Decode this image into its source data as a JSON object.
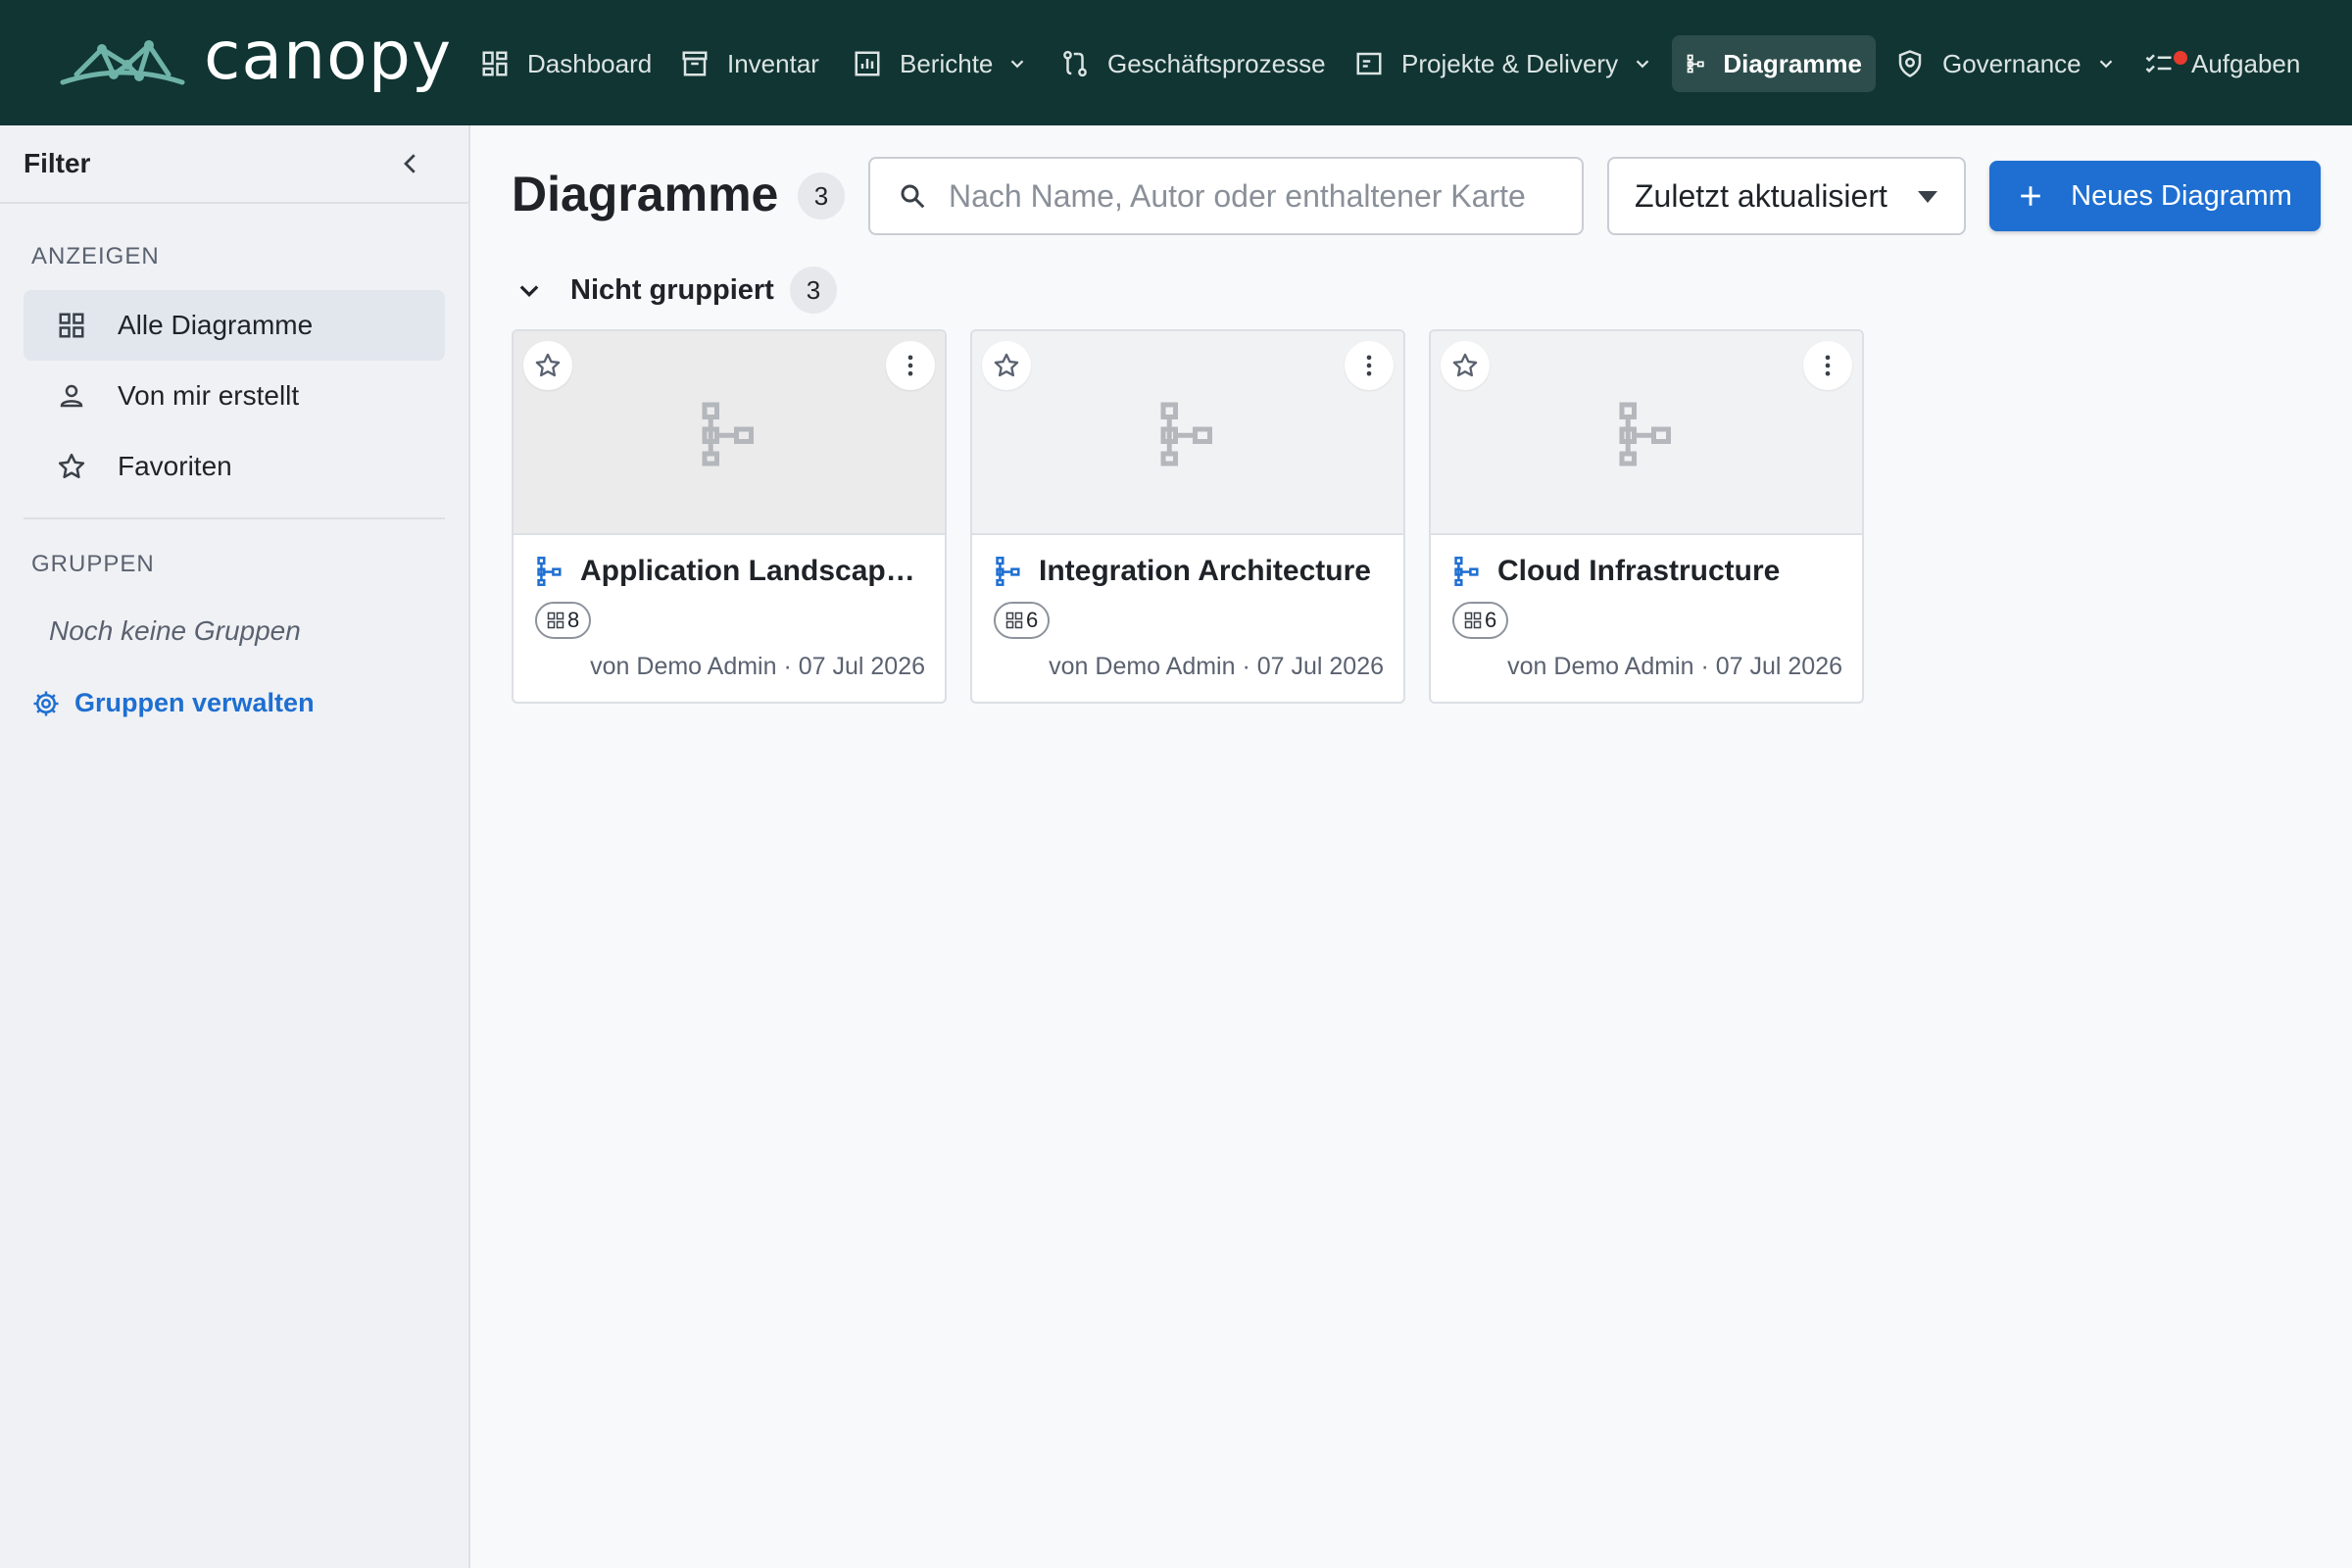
{
  "app": {
    "brand": "canopy",
    "brand_color": "#103533",
    "accent_color": "#1e6fd1"
  },
  "nav": {
    "items": [
      {
        "label": "Dashboard",
        "icon": "dashboard-icon"
      },
      {
        "label": "Inventar",
        "icon": "archive-icon"
      },
      {
        "label": "Berichte",
        "icon": "bar-chart-icon",
        "has_dropdown": true
      },
      {
        "label": "Geschäftsprozesse",
        "icon": "process-icon"
      },
      {
        "label": "Projekte & Delivery",
        "icon": "project-icon",
        "has_dropdown": true
      },
      {
        "label": "Diagramme",
        "icon": "diagram-icon",
        "active": true
      },
      {
        "label": "Governance",
        "icon": "shield-icon",
        "has_dropdown": true
      },
      {
        "label": "Aufgaben",
        "icon": "checklist-icon",
        "has_notification": true
      }
    ]
  },
  "sidebar": {
    "title": "Filter",
    "show_section": "ANZEIGEN",
    "items": [
      {
        "label": "Alle Diagramme",
        "icon": "grid-icon",
        "active": true
      },
      {
        "label": "Von mir erstellt",
        "icon": "user-icon"
      },
      {
        "label": "Favoriten",
        "icon": "star-icon"
      }
    ],
    "groups_section": "GRUPPEN",
    "groups_empty": "Noch keine Gruppen",
    "manage_groups": "Gruppen verwalten"
  },
  "main": {
    "title": "Diagramme",
    "count": "3",
    "search": {
      "placeholder": "Nach Name, Autor oder enthaltener Karte",
      "value": ""
    },
    "sort": {
      "selected": "Zuletzt aktualisiert"
    },
    "new_button": "Neues Diagramm",
    "group": {
      "label": "Nicht gruppiert",
      "count": "3"
    },
    "cards": [
      {
        "title": "Application Landscape ...",
        "card_count": "8",
        "meta": "von Demo Admin · 07 Jul 2026"
      },
      {
        "title": "Integration Architecture",
        "card_count": "6",
        "meta": "von Demo Admin · 07 Jul 2026"
      },
      {
        "title": "Cloud Infrastructure",
        "card_count": "6",
        "meta": "von Demo Admin · 07 Jul 2026"
      }
    ]
  }
}
